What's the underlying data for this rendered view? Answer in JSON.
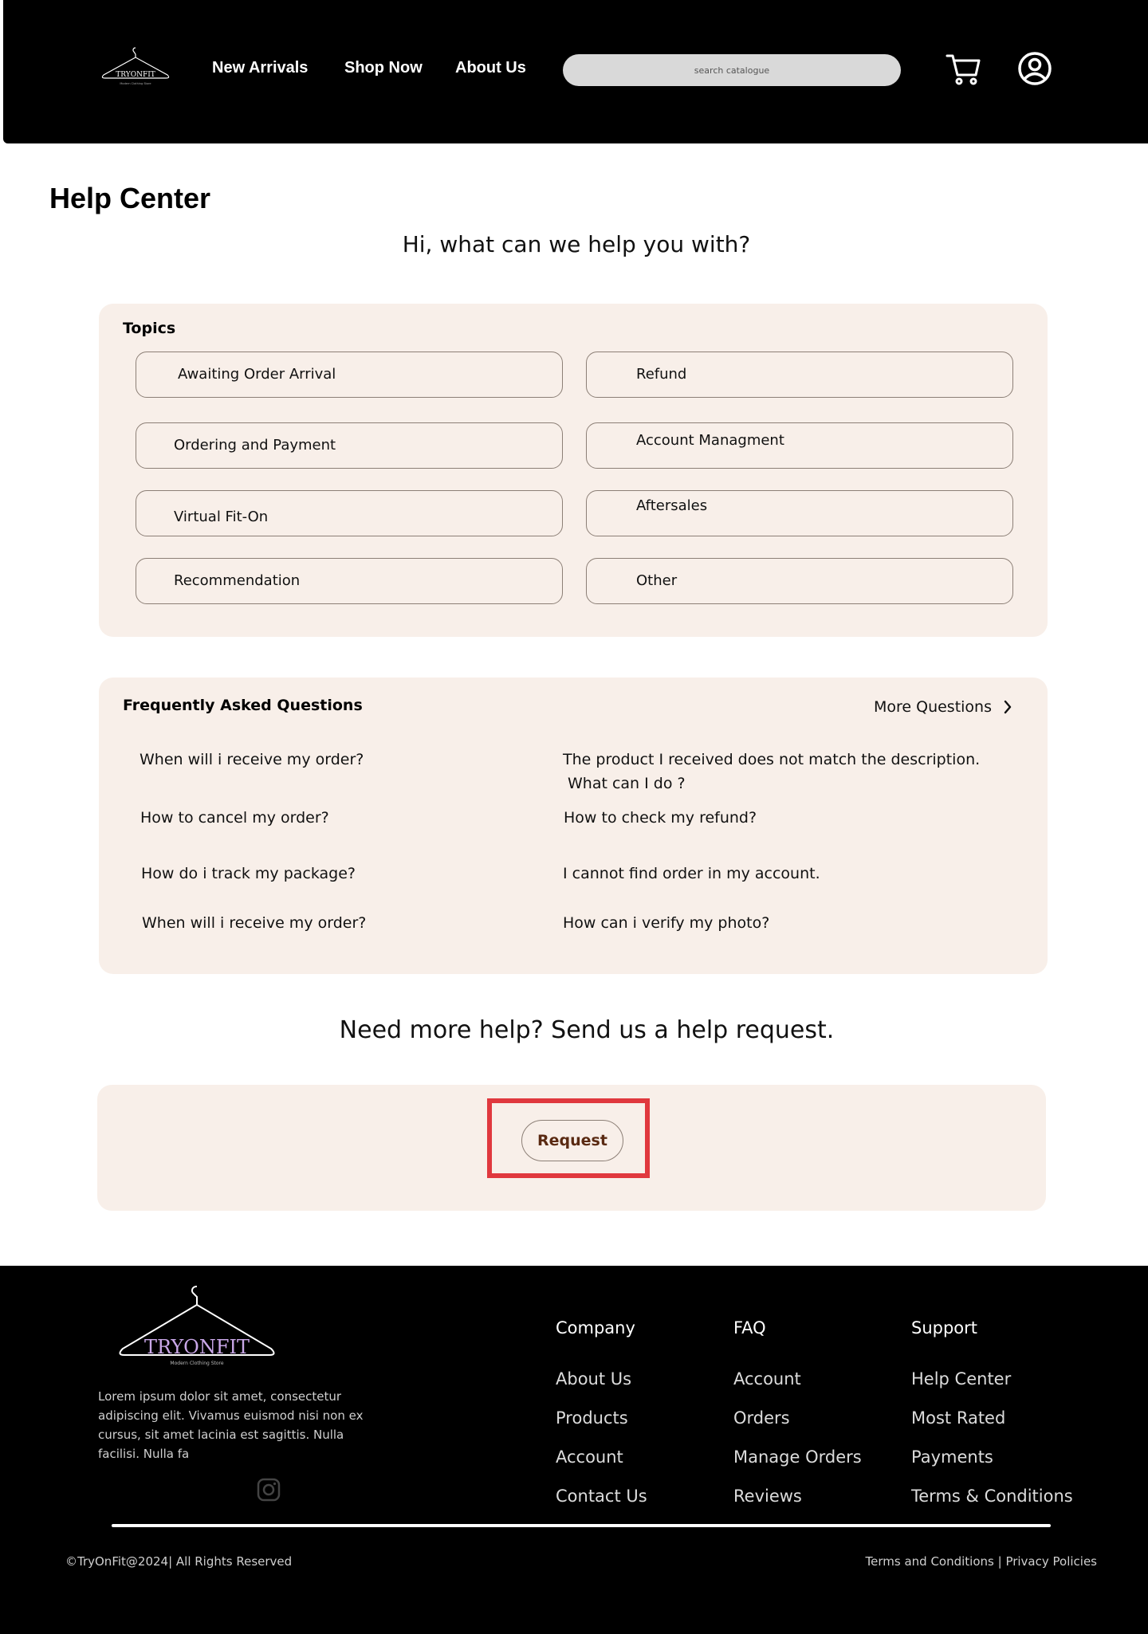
{
  "header": {
    "logo_icon": "hanger-logo-icon",
    "nav": [
      "New Arrivals",
      "Shop Now",
      "About Us"
    ],
    "search_placeholder": "search catalogue",
    "cart_icon": "cart-icon",
    "account_icon": "user-circle-icon"
  },
  "page": {
    "title": "Help Center",
    "subtitle": "Hi, what can we help you with?"
  },
  "topics": {
    "title": "Topics",
    "items": [
      "Awaiting Order Arrival",
      "Refund",
      "Ordering and Payment",
      "Account Managment",
      "Virtual Fit-On",
      "Aftersales",
      "Recommendation",
      "Other"
    ]
  },
  "faq": {
    "title": "Frequently Asked Questions",
    "more": "More Questions",
    "left": [
      "When will i receive my order?",
      "How to cancel my order?",
      "How do i track my package?",
      "When will i receive my order?"
    ],
    "right": [
      "The product I received does not match the description.",
      "How to check my refund?",
      "I cannot find order in my account.",
      "How can i verify my photo?"
    ],
    "right_first_line2": "What can I do ?"
  },
  "help": {
    "heading": "Need more help? Send us a help request.",
    "button": "Request"
  },
  "footer": {
    "logo_icon": "tryonfit-logo-icon",
    "description": "Lorem ipsum dolor sit amet, consectetur adipiscing elit. Vivamus euismod nisi non ex cursus, sit amet lacinia est sagittis. Nulla facilisi. Nulla fa",
    "social_icon": "instagram-icon",
    "columns": [
      {
        "title": "Company",
        "links": [
          "About Us",
          "Products",
          "Account",
          "Contact Us"
        ]
      },
      {
        "title": "FAQ",
        "links": [
          "Account",
          "Orders",
          "Manage Orders",
          "Reviews"
        ]
      },
      {
        "title": "Support",
        "links": [
          "Help Center",
          "Most Rated",
          "Payments",
          "Terms & Conditions"
        ]
      }
    ],
    "copyright": "©TryOnFit@2024| All Rights Reserved",
    "terms": "Terms and Conditions",
    "separator": " | ",
    "privacy": "Privacy Policies"
  },
  "colors": {
    "header_bg": "#000000",
    "card_bg": "#f8efe9",
    "highlight": "#e0383e",
    "button_text": "#5a2a12"
  }
}
